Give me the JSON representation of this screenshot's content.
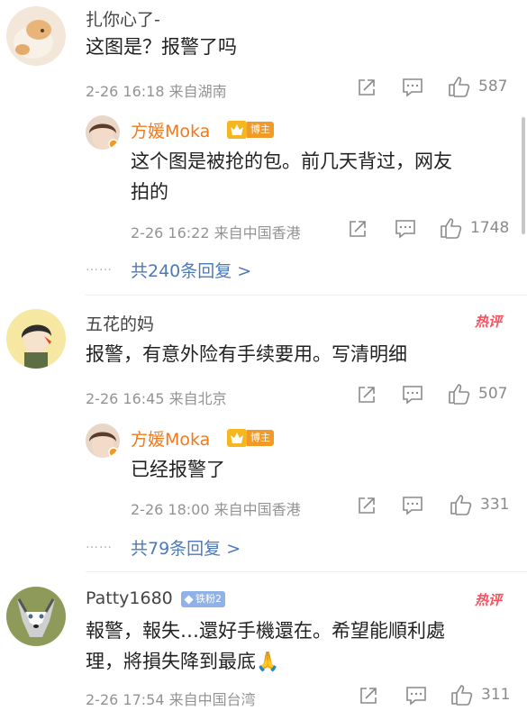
{
  "comments": [
    {
      "user": "扎你心了-",
      "text": "这图是？报警了吗",
      "meta": "2-26 16:18 来自湖南",
      "likes": "587",
      "reply": {
        "user": "方媛Moka",
        "badge": "博主",
        "text_line1": "这个图是被抢的包。前几天背过，网友",
        "text_line2": "拍的",
        "meta": "2-26 16:22 来自中国香港",
        "likes": "1748"
      },
      "more_replies": "共240条回复 >"
    },
    {
      "user": "五花的妈",
      "hot_label": "热评",
      "text": "报警，有意外险有手续要用。写清明细",
      "meta": "2-26 16:45 来自北京",
      "likes": "507",
      "reply": {
        "user": "方媛Moka",
        "badge": "博主",
        "text": "已经报警了",
        "meta": "2-26 18:00 来自中国香港",
        "likes": "331"
      },
      "more_replies": "共79条回复 >"
    },
    {
      "user": "Patty1680",
      "fan_badge": "铁粉2",
      "hot_label": "热评",
      "text_line1": "報警，報失…還好手機還在。希望能順利處",
      "text_line2": "理，將損失降到最底🙏",
      "meta": "2-26 17:54 来自中国台湾",
      "likes": "311"
    }
  ],
  "dots_text": "……",
  "colors": {
    "blogger_name": "#ee7a1f",
    "link": "#4c7ab8",
    "hot": "#f5515f",
    "meta": "#939393"
  },
  "icons": [
    "share-icon",
    "comment-icon",
    "like-icon",
    "crown-icon",
    "diamond-icon"
  ]
}
